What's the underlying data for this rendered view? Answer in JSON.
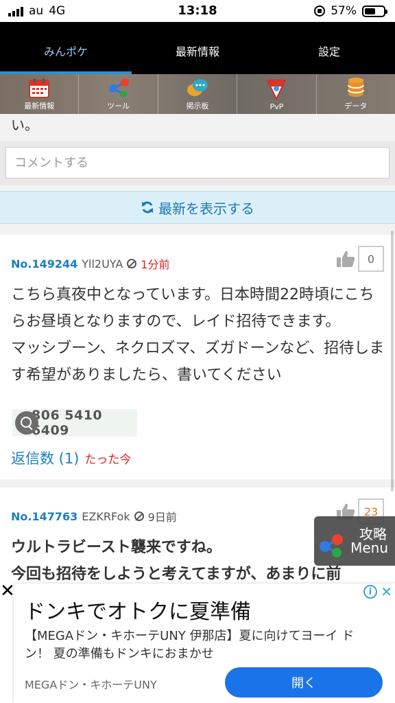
{
  "status_bar": {
    "carrier": "au",
    "network": "4G",
    "time": "13:18",
    "battery": "57%"
  },
  "nav": {
    "tabs": [
      {
        "label": "みんポケ"
      },
      {
        "label": "最新情報"
      },
      {
        "label": "設定"
      }
    ]
  },
  "icon_bar": {
    "items": [
      {
        "label": "最新情報",
        "icon": "calendar-icon"
      },
      {
        "label": "ツール",
        "icon": "share-nodes-icon"
      },
      {
        "label": "掲示板",
        "icon": "chat-bubbles-icon"
      },
      {
        "label": "PvP",
        "icon": "pvp-badge-icon"
      },
      {
        "label": "データ",
        "icon": "database-icon"
      }
    ]
  },
  "content": {
    "cut_text": "い。",
    "comment_placeholder": "コメントする",
    "refresh_label": "最新を表示する"
  },
  "posts": [
    {
      "no": "No.149244",
      "user_id": "Yll2UYA",
      "time": "1分前",
      "likes": "0",
      "body": "こちら真夜中となっています。日本時間22時頃にこちらお昼頃となりますので、レイド招待できます。\nマッシブーン、ネクロズマ、ズガドーンなど、招待します希望がありましたら、書いてください",
      "phone_image_text": "806 5410 6409",
      "replies": "返信数 (1)",
      "reply_time": "たった今"
    },
    {
      "no": "No.147763",
      "user_id": "EZKRFok",
      "time": "9日前",
      "likes": "23",
      "body": "ウルトラビースト襲来ですね。\n今回も招待をしようと考えてますが、あまりに前"
    }
  ],
  "floating_menu": {
    "line1": "攻略",
    "line2": "Menu"
  },
  "ad": {
    "title": "ドンキでオトクに夏準備",
    "description": "【MEGAドン・キホーテUNY 伊那店】夏に向けてヨーイ ドン！ 夏の準備もドンキにおまかせ",
    "advertiser": "MEGAドン・キホーテUNY",
    "button": "開く",
    "close": "✕",
    "info": "i"
  },
  "colors": {
    "accent_blue": "#1b7fc0",
    "time_red": "#e02020",
    "nav_black": "#000000",
    "refresh_bg": "#dbeff9",
    "ad_button": "#1a73e8"
  }
}
